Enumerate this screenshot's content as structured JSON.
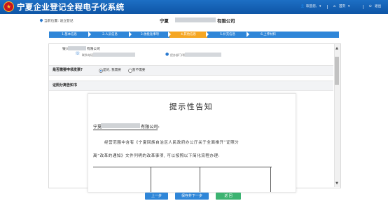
{
  "header": {
    "emblem_glyph": "★",
    "title": "宁夏企业登记全程电子化系统",
    "user_greeting": "欢迎您,",
    "home_label": "首页",
    "exit_label": "退出"
  },
  "location": {
    "label": "当前位置: 设立登记",
    "company_prefix": "宁夏",
    "company_suffix": "有限公司"
  },
  "steps": [
    {
      "label": "1.基本信息",
      "active": false
    },
    {
      "label": "2.人员信息",
      "active": false
    },
    {
      "label": "3.依批准事项",
      "active": false
    },
    {
      "label": "4.其他信息",
      "active": true
    },
    {
      "label": "5.补充信息",
      "active": false
    },
    {
      "label": "6.上传材料",
      "active": false
    }
  ],
  "bank": {
    "prefix": "银川",
    "suffix": "有限公司",
    "phone_label": "联系电话:",
    "dept_label": "经办部门/机构:"
  },
  "license_question": {
    "title": "是否需要申领发票?",
    "options": [
      {
        "label": "是的, 我需要",
        "checked": true
      },
      {
        "label": "暂不需要",
        "checked": false
      }
    ]
  },
  "notice_section": {
    "title": "证照分离告知书"
  },
  "notice": {
    "title": "提示性告知",
    "addressee_prefix": "宁夏",
    "addressee_suffix": "有限公司:",
    "line1": "经营范围中含有《宁夏回族自治区人民政府办公厅关于全面推开“证照分",
    "line2": "离”改革的通知》文件列明的改革事项, 可以按照以下简化流程办理:"
  },
  "buttons": {
    "prev": "上一步",
    "save_next": "保存并下一步",
    "back": "返 回"
  },
  "colors": {
    "header": "#1565b8",
    "step": "#2f86d8",
    "step_active": "#f5a623",
    "button": "#2f86d8",
    "back_button": "#3cb371"
  }
}
